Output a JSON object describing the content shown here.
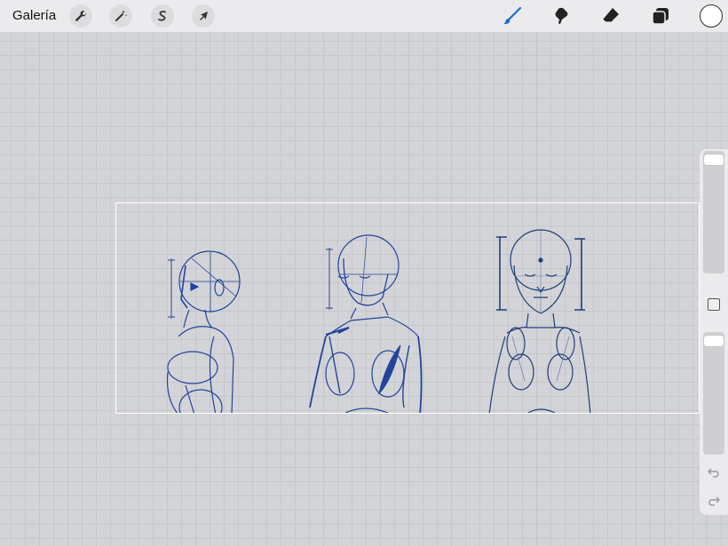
{
  "toolbar": {
    "gallery_label": "Galería",
    "left_tools": [
      {
        "icon": "wrench-icon",
        "name": "actions"
      },
      {
        "icon": "magic-wand-icon",
        "name": "adjustments"
      },
      {
        "icon": "selection-s-icon",
        "name": "selection"
      },
      {
        "icon": "arrow-cursor-icon",
        "name": "transform"
      }
    ],
    "right_tools": [
      {
        "icon": "brush-icon",
        "name": "paint",
        "active": true
      },
      {
        "icon": "smudge-icon",
        "name": "smudge"
      },
      {
        "icon": "eraser-icon",
        "name": "eraser"
      },
      {
        "icon": "layers-icon",
        "name": "layers"
      }
    ],
    "current_color": "#ffffff",
    "active_color": "#1a6fd0"
  },
  "sidebar": {
    "brush_size_icon": "size-slider",
    "opacity_icon": "opacity-slider",
    "modify_icon": "square-icon",
    "undo_icon": "undo-arrow-icon",
    "redo_icon": "redo-arrow-icon"
  },
  "canvas": {
    "stroke_color": "#1f3f9a",
    "figures": [
      "profile-figure",
      "three-quarter-figure",
      "front-figure"
    ]
  }
}
